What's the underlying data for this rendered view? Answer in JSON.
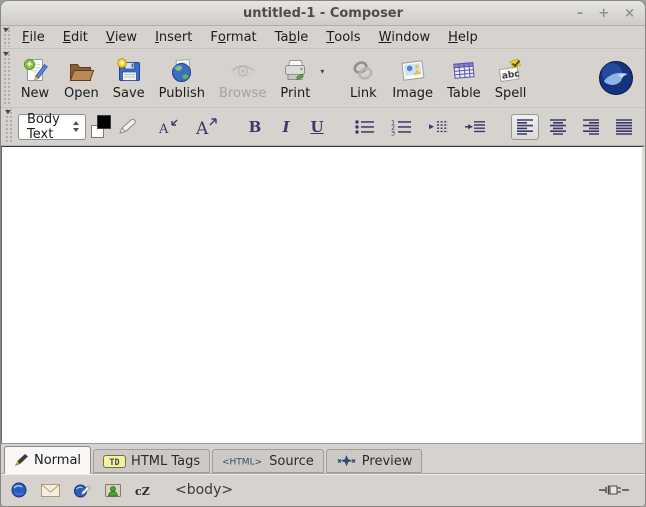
{
  "colors": {
    "window_bg": "#d6d2ce",
    "icon_navy": "#39396b",
    "logo_blue": "#16337f",
    "active_tab_bg": "#f9f8f7",
    "text_color_swatch": "#000000",
    "background_color_swatch": "#ffffff"
  },
  "window": {
    "title": "untitled-1 - Composer",
    "controls": {
      "minimize": "–",
      "maximize": "+",
      "close": "×"
    }
  },
  "menubar": {
    "items": [
      {
        "label": "File",
        "mnemonic": "F"
      },
      {
        "label": "Edit",
        "mnemonic": "E"
      },
      {
        "label": "View",
        "mnemonic": "V"
      },
      {
        "label": "Insert",
        "mnemonic": "I"
      },
      {
        "label": "Format",
        "mnemonic": "o"
      },
      {
        "label": "Table",
        "mnemonic": "b"
      },
      {
        "label": "Tools",
        "mnemonic": "T"
      },
      {
        "label": "Window",
        "mnemonic": "W"
      },
      {
        "label": "Help",
        "mnemonic": "H"
      }
    ]
  },
  "toolbar": {
    "buttons": [
      {
        "label": "New",
        "icon": "new-page-icon",
        "disabled": false
      },
      {
        "label": "Open",
        "icon": "open-folder-icon",
        "disabled": false
      },
      {
        "label": "Save",
        "icon": "save-floppy-icon",
        "disabled": false
      },
      {
        "label": "Publish",
        "icon": "publish-globe-icon",
        "disabled": false
      },
      {
        "label": "Browse",
        "icon": "browse-eye-icon",
        "disabled": true
      },
      {
        "label": "Print",
        "icon": "print-printer-icon",
        "disabled": false,
        "has_dropdown": true
      },
      {
        "label": "Link",
        "icon": "link-chain-icon",
        "disabled": false
      },
      {
        "label": "Image",
        "icon": "image-photo-icon",
        "disabled": false
      },
      {
        "label": "Table",
        "icon": "table-grid-icon",
        "disabled": false
      },
      {
        "label": "Spell",
        "icon": "spell-check-icon",
        "disabled": false
      }
    ],
    "logo_icon": "seamonkey-logo"
  },
  "formatbar": {
    "paragraph_style": {
      "value": "Body Text"
    },
    "color_picker": {
      "foreground": "#000000",
      "background": "#ffffff"
    },
    "highlight_icon": "highlight-pen-icon",
    "buttons": [
      {
        "name": "smaller-font-button",
        "icon": "smaller-font-icon"
      },
      {
        "name": "larger-font-button",
        "icon": "larger-font-icon"
      },
      {
        "name": "bold-button",
        "label": "B",
        "style": "bold"
      },
      {
        "name": "italic-button",
        "label": "I",
        "style": "italic"
      },
      {
        "name": "underline-button",
        "label": "U",
        "style": "underline"
      },
      {
        "name": "bullet-list-button",
        "icon": "bullet-list-icon"
      },
      {
        "name": "numbered-list-button",
        "icon": "numbered-list-icon"
      },
      {
        "name": "outdent-button",
        "icon": "outdent-icon"
      },
      {
        "name": "indent-button",
        "icon": "indent-icon"
      },
      {
        "name": "align-left-button",
        "icon": "align-left-icon",
        "pressed": true
      },
      {
        "name": "align-center-button",
        "icon": "align-center-icon"
      },
      {
        "name": "align-right-button",
        "icon": "align-right-icon"
      },
      {
        "name": "justify-button",
        "icon": "justify-icon"
      }
    ]
  },
  "editor": {
    "content": ""
  },
  "mode_tabs": [
    {
      "label": "Normal",
      "icon": "edit-mode-pen-icon",
      "active": true
    },
    {
      "label": "HTML Tags",
      "icon": "html-tags-td-icon",
      "active": false
    },
    {
      "label": "Source",
      "icon": "html-source-icon",
      "active": false
    },
    {
      "label": "Preview",
      "icon": "preview-icon",
      "active": false
    }
  ],
  "statusbar": {
    "component_icons": [
      "navigator-globe-icon",
      "mail-envelope-icon",
      "composer-icon",
      "addressbook-icon",
      "chatzilla-icon"
    ],
    "breadcrumb": "<body>",
    "online_icon": "online-plug-icon"
  }
}
